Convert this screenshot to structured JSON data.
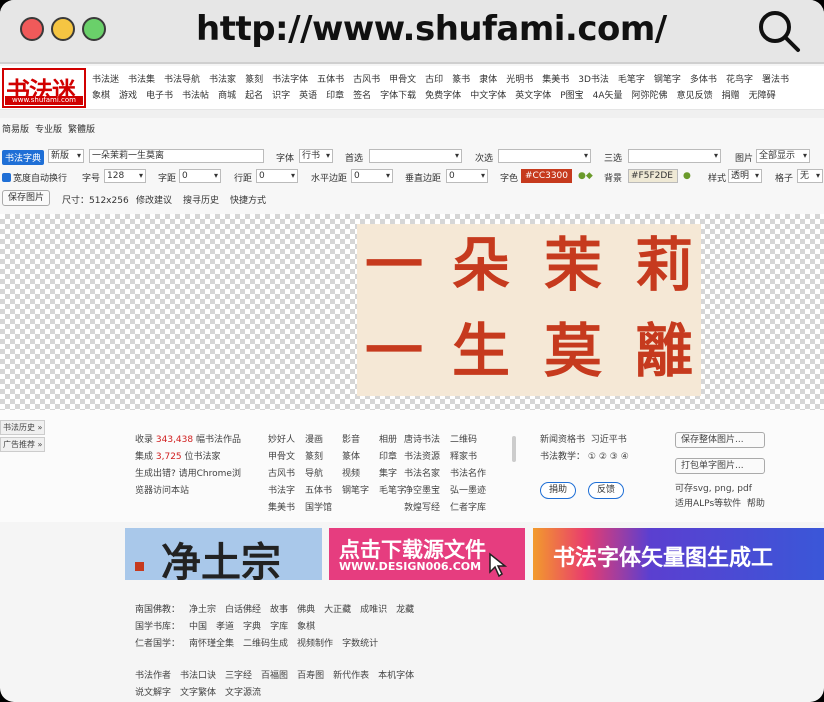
{
  "browser": {
    "url": "http://www.shufami.com/"
  },
  "site": {
    "logo": "书法迷",
    "logo_sub": "www.shufami.com"
  },
  "nav_row1": [
    "书法迷",
    "书法集",
    "书法导航",
    "书法家",
    "篆刻",
    "书法字体",
    "五体书",
    "古风书",
    "甲骨文",
    "古印",
    "篆书",
    "隶体",
    "光明书",
    "集美书",
    "3D书法",
    "毛笔字",
    "钢笔字",
    "多体书",
    "花鸟字",
    "署法书"
  ],
  "nav_row2": [
    "象棋",
    "游戏",
    "电子书",
    "书法帖",
    "商城",
    "起名",
    "识字",
    "英语",
    "印章",
    "签名",
    "字体下载",
    "免费字体",
    "中文字体",
    "英文字体",
    "P图宝",
    "4A矢量",
    "阿弥陀佛",
    "意见反馈",
    "捐赠",
    "无障碍"
  ],
  "modes": [
    "简易版",
    "专业版",
    "繁體版"
  ],
  "tool": {
    "badge": "书法字典",
    "script_select": "新版",
    "text_input": "一朵茉莉一生莫离",
    "font_label": "字体",
    "font_select": "行书",
    "pref_label": "首选",
    "second_label": "次选",
    "third_label": "三选",
    "img_label": "图片",
    "img_select": "全部显示",
    "wrap_label": "宽度自动换行",
    "size_label": "字号",
    "size_val": "128",
    "spacing_label": "字距",
    "spacing_val": "0",
    "linegap_label": "行距",
    "linegap_val": "0",
    "hshift_label": "水平边距",
    "hshift_val": "0",
    "vshift_label": "垂直边距",
    "vshift_val": "0",
    "color_label": "字色",
    "color_val": "#CC3300",
    "bg_label": "背景",
    "bg_val": "#F5F2DE",
    "style_label": "样式",
    "style_select": "透明",
    "grid_label": "格子",
    "grid_select": "无",
    "save_btn": "保存图片",
    "size_info": "尺寸：512x256",
    "suggest": "修改建议",
    "history": "搜寻历史",
    "shortcut": "快捷方式"
  },
  "preview_chars": [
    "一",
    "朵",
    "茉",
    "莉",
    "一",
    "生",
    "莫",
    "離"
  ],
  "side": {
    "history": "书法历史 »",
    "favorites": "广告推荐 »"
  },
  "stats": {
    "l1a": "收录",
    "works": "343,438",
    "l1b": "幅书法作品",
    "l2a": "集成",
    "artists": "3,725",
    "l2b": "位书法家",
    "l3": "生成出错? 请用Chrome浏",
    "l4": "览器访问本站"
  },
  "col_b": [
    "妙好人",
    "漫画",
    "影音",
    "相册",
    "甲骨文",
    "篆刻",
    "篆体",
    "印章",
    "古风书",
    "导航",
    "视频",
    "集字",
    "书法字",
    "五体书",
    "钢笔字",
    "毛笔字",
    "集美书",
    "国学馆"
  ],
  "col_c": [
    "唐诗书法",
    "二维码",
    "书法资源",
    "释家书",
    "书法名家",
    "书法名作",
    "净空墨宝",
    "弘一墨迹",
    "敦煌写经",
    "仁者字库"
  ],
  "col_d": {
    "l1": "新闻资格书",
    "l1b": "习近平书",
    "l2": "书法教学：",
    "nums": [
      "①",
      "②",
      "③",
      "④"
    ],
    "b1": "捐助",
    "b2": "反馈"
  },
  "col_e": {
    "b1": "保存整体图片...",
    "b2": "打包单字图片...",
    "l1": "可存svg, png, pdf",
    "l2": "适用ALPs等软件",
    "l3": "帮助"
  },
  "banners": {
    "b1": "净土宗",
    "b2": "点击下载源文件",
    "b2_sub": "WWW.DESIGN006.COM",
    "b3": "书法字体矢量图生成工"
  },
  "footer1": [
    "南国佛教：",
    "净土宗",
    "白话佛经",
    "故事",
    "佛典",
    "大正藏",
    "成唯识",
    "龙藏"
  ],
  "footer2": [
    "国学书库：",
    "中国",
    "孝道",
    "字典",
    "字库",
    "象棋"
  ],
  "footer3": [
    "仁者国学：",
    "南怀瑾全集",
    "二维码生成",
    "视频制作",
    "字数统计"
  ],
  "footer4": [
    "书法作者",
    "书法口诀",
    "三字经",
    "百福图",
    "百寿图",
    "新代作表",
    "本机字体"
  ],
  "footer5": [
    "说文解字",
    "文字繁体",
    "文字源流"
  ]
}
